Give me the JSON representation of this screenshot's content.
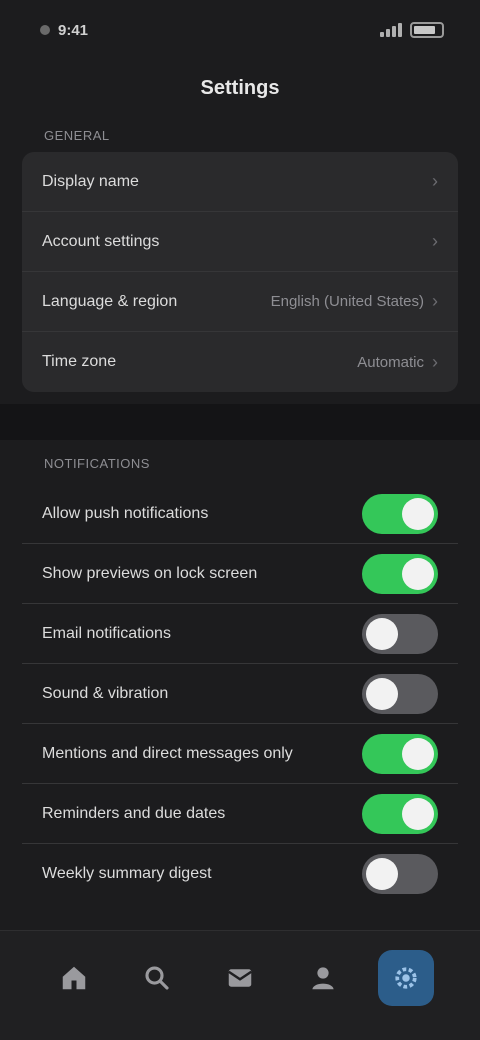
{
  "status_bar": {
    "time": "9:41",
    "battery": ""
  },
  "header": {
    "title": "Settings"
  },
  "section_general": {
    "label": "GENERAL",
    "rows": [
      {
        "label": "Display name",
        "value": ""
      },
      {
        "label": "Account settings",
        "value": ""
      },
      {
        "label": "Language & region",
        "value": "English (United States)"
      },
      {
        "label": "Time zone",
        "value": "Automatic"
      }
    ]
  },
  "section_notifications": {
    "label": "NOTIFICATIONS",
    "rows": [
      {
        "label": "Allow push notifications",
        "on": true
      },
      {
        "label": "Show previews on lock screen",
        "on": true
      },
      {
        "label": "Email notifications",
        "on": false
      },
      {
        "label": "Sound & vibration",
        "on": false
      },
      {
        "label": "Mentions and direct messages only",
        "on": true
      },
      {
        "label": "Reminders and due dates",
        "on": true
      },
      {
        "label": "Weekly summary digest",
        "on": false
      }
    ]
  },
  "tab_bar": {
    "tabs": [
      {
        "name": "home-icon"
      },
      {
        "name": "search-icon"
      },
      {
        "name": "inbox-icon"
      },
      {
        "name": "profile-icon"
      },
      {
        "name": "settings-icon",
        "active": true
      }
    ]
  },
  "colors": {
    "background": "#1c1c1e",
    "toggle_on": "#34c759",
    "active_tab": "#2c5d8a"
  }
}
